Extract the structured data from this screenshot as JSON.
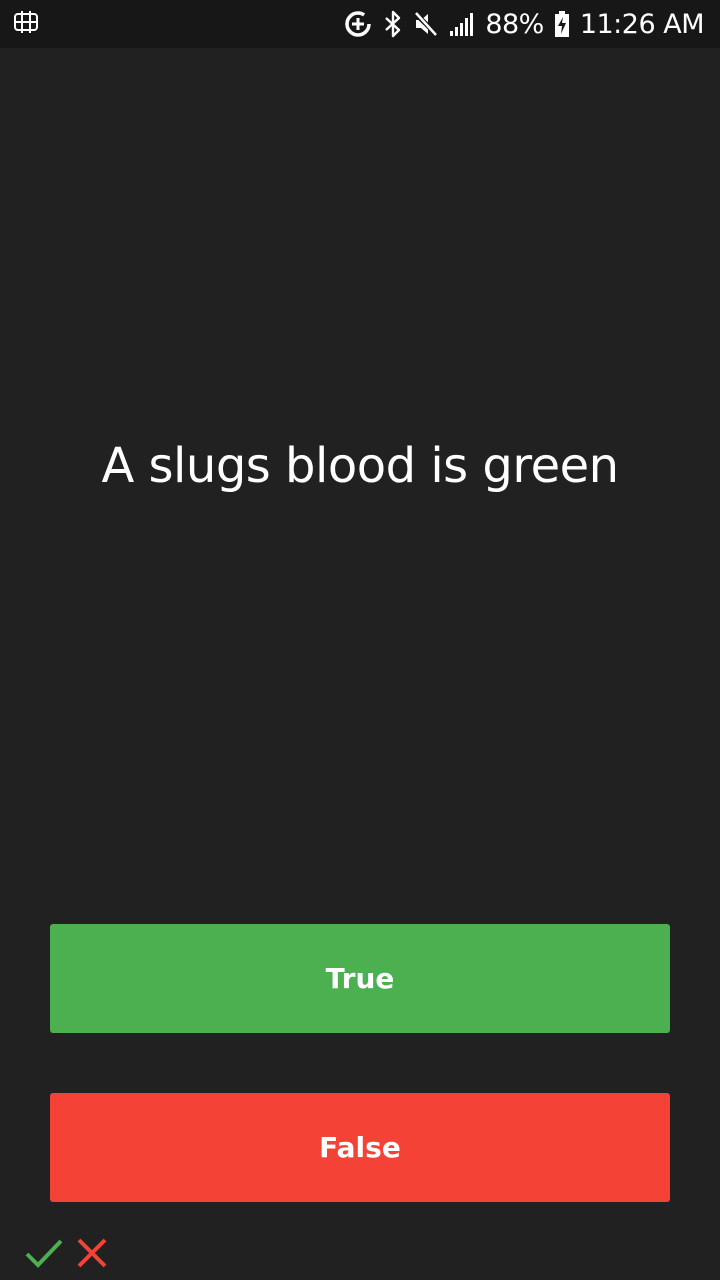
{
  "status_bar": {
    "battery": "88%",
    "time": "11:26 AM",
    "icons": [
      "screen-mirror-icon",
      "data-saver-icon",
      "bluetooth-icon",
      "mute-icon",
      "signal-icon",
      "battery-charging-icon"
    ]
  },
  "quiz": {
    "question": "A slugs blood is green",
    "true_label": "True",
    "false_label": "False"
  },
  "score_indicators": [
    {
      "icon": "check-icon",
      "color": "#4caf50"
    },
    {
      "icon": "cross-icon",
      "color": "#f44336"
    }
  ],
  "colors": {
    "background": "#212121",
    "true_button": "#4caf50",
    "false_button": "#f44336"
  }
}
